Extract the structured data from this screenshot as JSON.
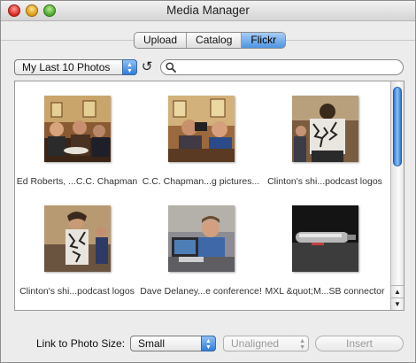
{
  "window": {
    "title": "Media Manager"
  },
  "tabs": [
    {
      "label": "Upload",
      "active": false
    },
    {
      "label": "Catalog",
      "active": false
    },
    {
      "label": "Flickr",
      "active": true
    }
  ],
  "toolbar": {
    "photo_set": "My Last 10 Photos",
    "refresh_icon": "refresh-icon",
    "search_icon": "search-icon",
    "search_value": ""
  },
  "photos": [
    {
      "caption": "Ed Roberts, ...C.C. Chapman"
    },
    {
      "caption": "C.C. Chapman...g pictures..."
    },
    {
      "caption": "Clinton's shi...podcast logos"
    },
    {
      "caption": "Clinton's shi...podcast logos"
    },
    {
      "caption": "Dave Delaney...e conference!"
    },
    {
      "caption": "MXL &quot;M...SB connector"
    }
  ],
  "footer": {
    "link_label": "Link to Photo Size:",
    "size_value": "Small",
    "alignment_value": "Unaligned",
    "insert_label": "Insert"
  },
  "colors": {
    "accent": "#4e95e2",
    "disabled_text": "#9a9a9a"
  }
}
